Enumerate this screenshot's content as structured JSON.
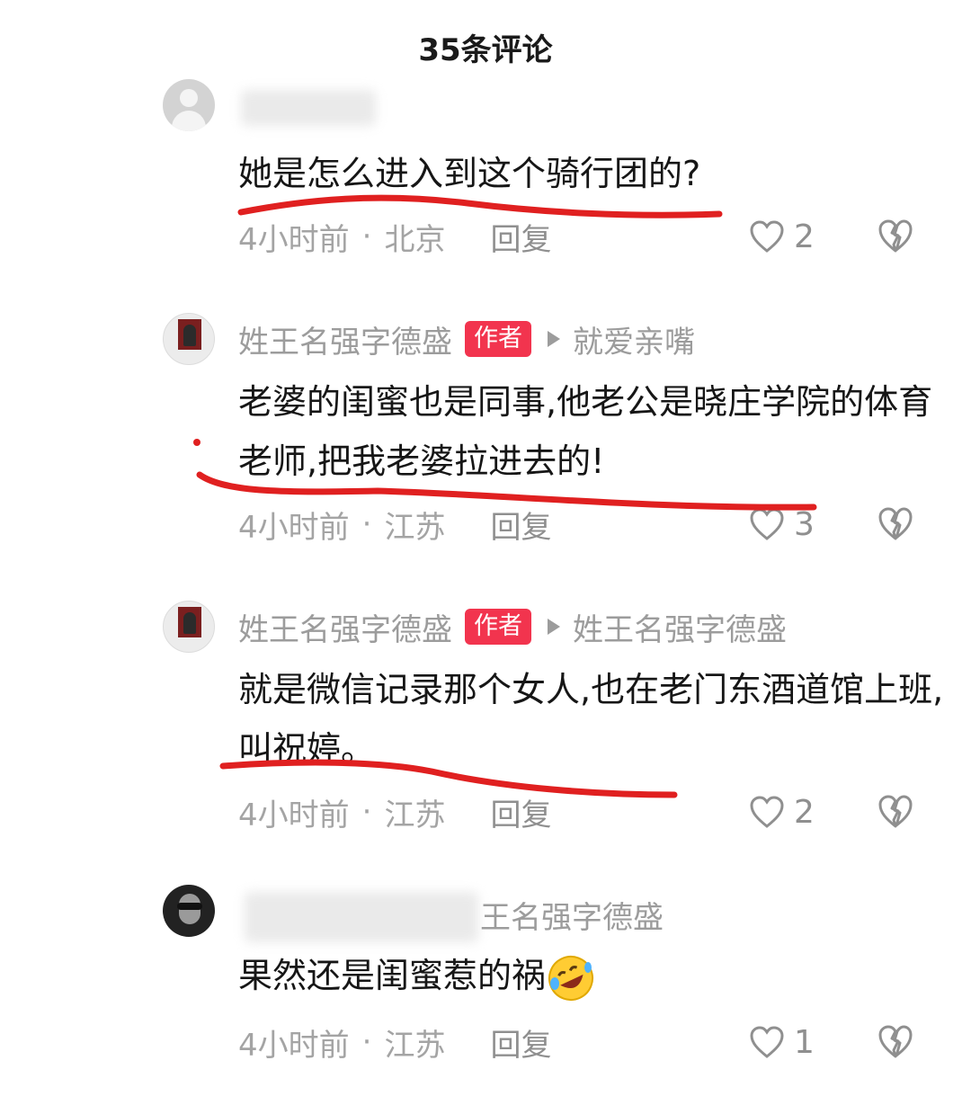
{
  "header": {
    "title": "35条评论"
  },
  "comments": [
    {
      "name": "",
      "badge": "",
      "reply_to": "",
      "text": "她是怎么进入到这个骑行团的?",
      "time": "4小时前",
      "location": "北京",
      "reply_label": "回复",
      "likes": "2"
    },
    {
      "name": "姓王名强字德盛",
      "badge": "作者",
      "reply_to": "就爱亲嘴",
      "text": "老婆的闺蜜也是同事,他老公是晓庄学院的体育老师,把我老婆拉进去的!",
      "time": "4小时前",
      "location": "江苏",
      "reply_label": "回复",
      "likes": "3"
    },
    {
      "name": "姓王名强字德盛",
      "badge": "作者",
      "reply_to": "姓王名强字德盛",
      "text": "就是微信记录那个女人,也在老门东酒道馆上班,叫祝婷。",
      "time": "4小时前",
      "location": "江苏",
      "reply_label": "回复",
      "likes": "2"
    },
    {
      "name": "",
      "badge": "",
      "reply_to": "王名强字德盛",
      "text": "果然还是闺蜜惹的祸",
      "time": "4小时前",
      "location": "江苏",
      "reply_label": "回复",
      "likes": "1"
    }
  ],
  "icons": {
    "like": "heart-outline-icon",
    "dislike": "broken-heart-icon",
    "emoji": "rofl-emoji-icon"
  },
  "colors": {
    "badge": "#f2344e",
    "annotation": "#e02020",
    "meta_text": "#a4a4a4"
  }
}
